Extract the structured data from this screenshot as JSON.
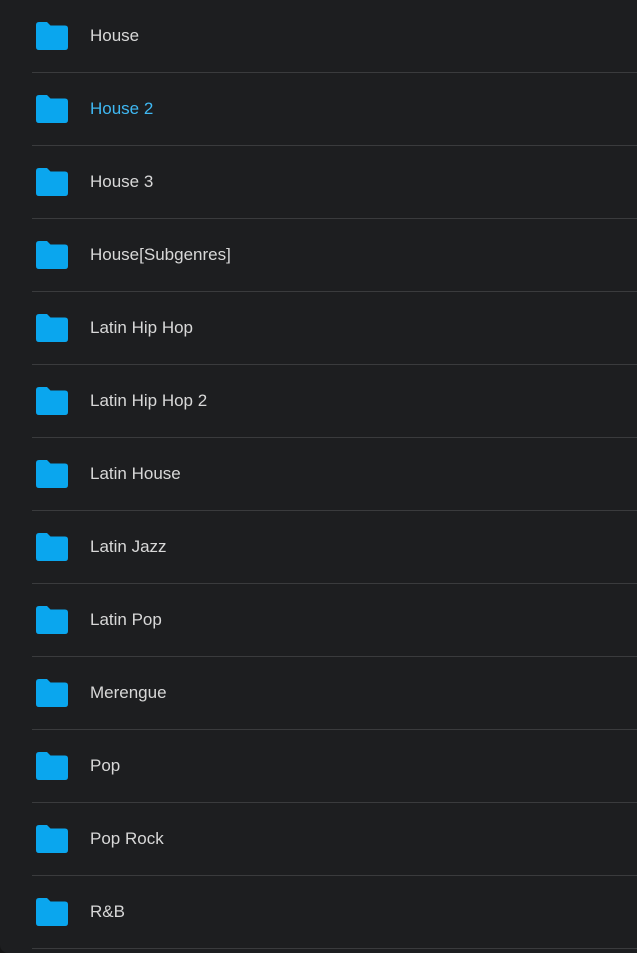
{
  "colors": {
    "background": "#1d1e20",
    "folder": "#0aa6ee",
    "text": "#d8d8d8",
    "active_text": "#3fb8f2",
    "divider": "#3a3b3d"
  },
  "folders": [
    {
      "label": "House",
      "icon": "folder-icon",
      "active": false
    },
    {
      "label": "House 2",
      "icon": "folder-icon",
      "active": true
    },
    {
      "label": "House 3",
      "icon": "folder-icon",
      "active": false
    },
    {
      "label": "House[Subgenres]",
      "icon": "folder-icon",
      "active": false
    },
    {
      "label": "Latin Hip Hop",
      "icon": "folder-icon",
      "active": false
    },
    {
      "label": "Latin Hip Hop 2",
      "icon": "folder-icon",
      "active": false
    },
    {
      "label": "Latin House",
      "icon": "folder-icon",
      "active": false
    },
    {
      "label": "Latin Jazz",
      "icon": "folder-icon",
      "active": false
    },
    {
      "label": "Latin Pop",
      "icon": "folder-icon",
      "active": false
    },
    {
      "label": "Merengue",
      "icon": "folder-icon",
      "active": false
    },
    {
      "label": "Pop",
      "icon": "folder-icon",
      "active": false
    },
    {
      "label": "Pop Rock",
      "icon": "folder-icon",
      "active": false
    },
    {
      "label": "R&B",
      "icon": "folder-icon",
      "active": false
    }
  ]
}
